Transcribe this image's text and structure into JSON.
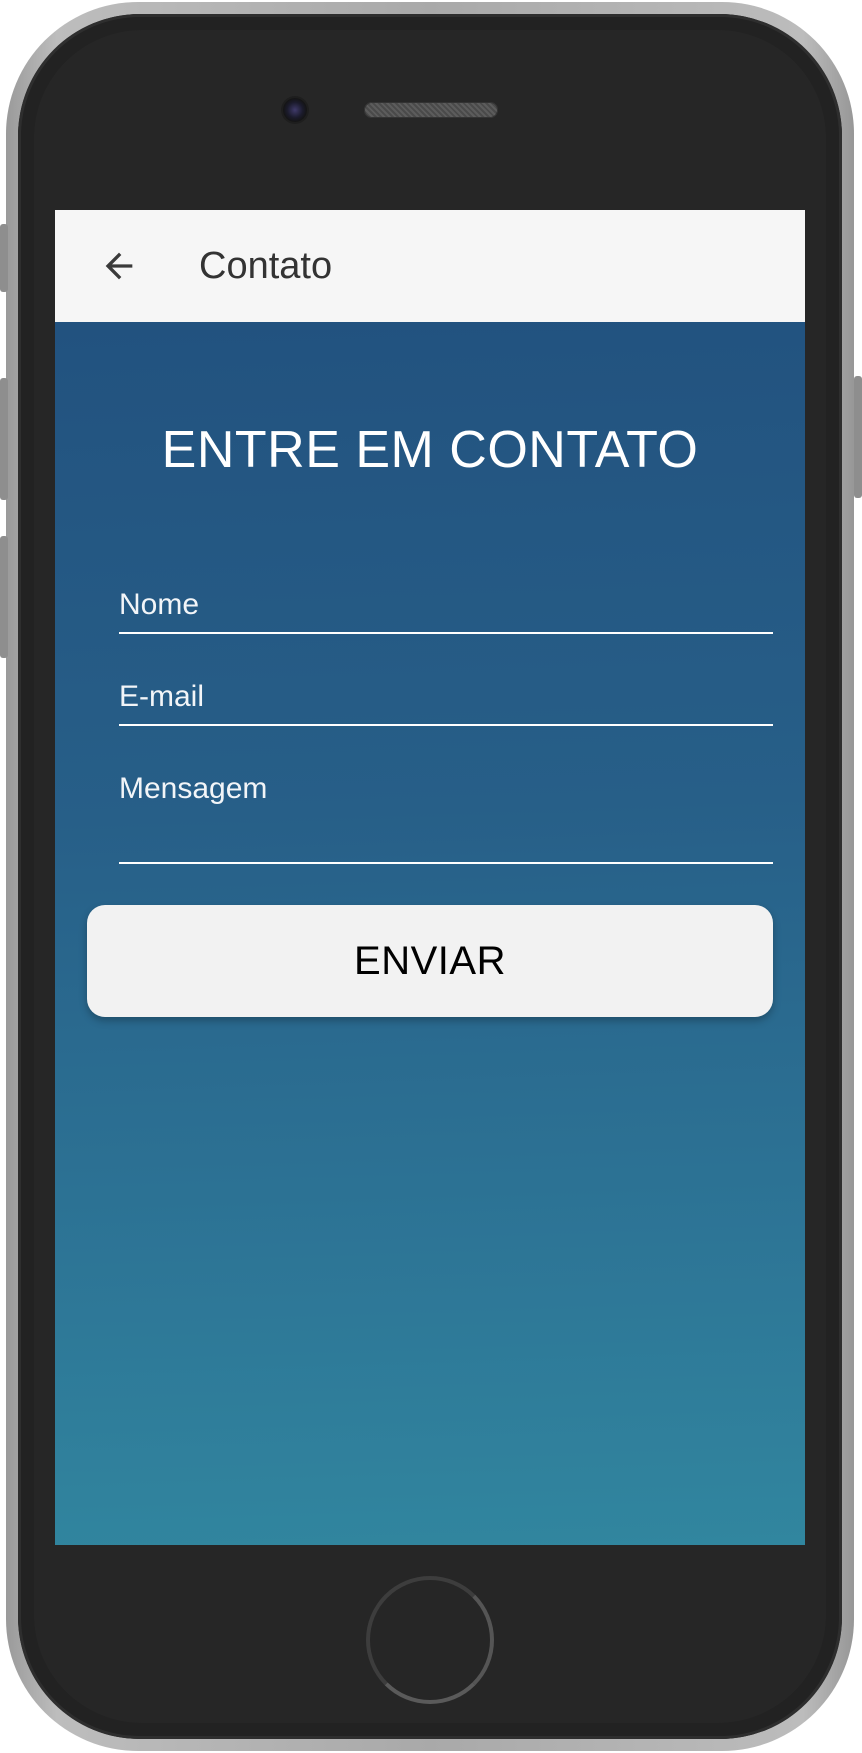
{
  "app_bar": {
    "title": "Contato",
    "back_icon": "arrow-left-icon"
  },
  "contact_form": {
    "heading": "ENTRE EM CONTATO",
    "name_placeholder": "Nome",
    "email_placeholder": "E-mail",
    "message_placeholder": "Mensagem",
    "submit_label": "ENVIAR"
  },
  "theme": {
    "app_bar_background": "#f6f6f6",
    "gradient_top": "#22527f",
    "gradient_bottom": "#31869f",
    "button_background": "#f2f2f2",
    "device_frame": "#262626"
  }
}
